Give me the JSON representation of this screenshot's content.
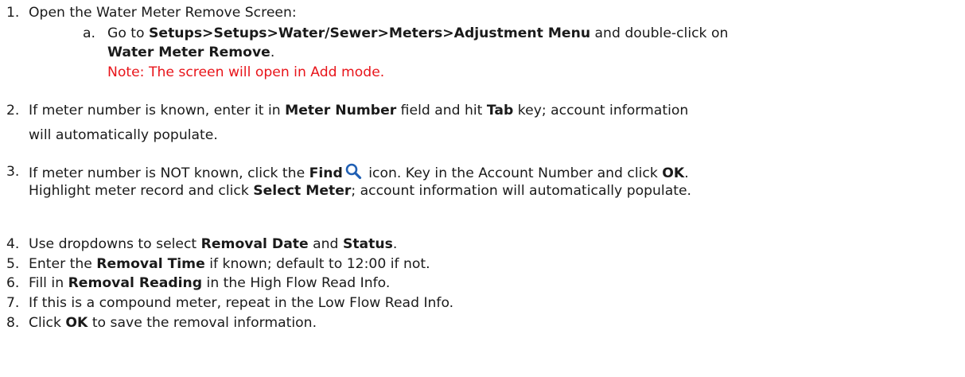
{
  "steps": [
    {
      "num": "1.",
      "lines": [
        [
          "Open the Water Meter Remove Screen:"
        ]
      ]
    },
    {
      "num": "2.",
      "lines": [
        [
          "If meter number is known, enter it in ",
          {
            "b": "Meter Number"
          },
          " field and hit ",
          {
            "b": "Tab"
          },
          " key; account information"
        ],
        [
          "will automatically populate."
        ]
      ]
    },
    {
      "num": "3.",
      "lines": [
        [
          "If meter number is NOT known, click the ",
          {
            "b": "Find"
          },
          {
            "icon": "search"
          },
          " icon. Key in the Account Number and click ",
          {
            "b": "OK"
          },
          "."
        ],
        [
          "Highlight meter record and click ",
          {
            "b": "Select Meter"
          },
          "; account information will automatically populate."
        ]
      ]
    },
    {
      "num": "4.",
      "lines": [
        [
          "Use dropdowns to select ",
          {
            "b": "Removal Date"
          },
          " and ",
          {
            "b": "Status"
          },
          "."
        ]
      ]
    },
    {
      "num": "5.",
      "lines": [
        [
          "Enter the ",
          {
            "b": "Removal Time"
          },
          " if known; default to 12:00 if not."
        ]
      ]
    },
    {
      "num": "6.",
      "lines": [
        [
          "Fill in ",
          {
            "b": "Removal Reading"
          },
          " in the High Flow Read Info."
        ]
      ]
    },
    {
      "num": "7.",
      "lines": [
        [
          "If this is a compound meter, repeat in the Low Flow Read Info."
        ]
      ]
    },
    {
      "num": "8.",
      "lines": [
        [
          "Click ",
          {
            "b": "OK"
          },
          " to save the removal information."
        ]
      ]
    }
  ],
  "substep": {
    "num": "a.",
    "lines": [
      [
        "Go to ",
        {
          "b": "Setups>Setups>Water/Sewer>Meters>Adjustment Menu"
        },
        " and double-click on"
      ],
      [
        {
          "b": "Water Meter Remove"
        },
        "."
      ]
    ],
    "note": "Note: The screen will open in Add mode."
  },
  "colors": {
    "note": "#e8141a",
    "icon": "#1f5fb4",
    "text": "#1a1a1a"
  },
  "icons": [
    "search-icon"
  ]
}
